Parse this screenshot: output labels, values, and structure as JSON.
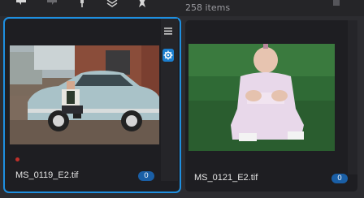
{
  "toolbar": {
    "icons": [
      "back-arrow-icon",
      "forward-arrow-icon",
      "pin-icon",
      "layers-icon",
      "star-icon"
    ],
    "item_count": "258 items"
  },
  "grid": {
    "items": [
      {
        "filename": "MS_0119_E2.tif",
        "badge": "0",
        "selected": true,
        "color_label": "#c0302a",
        "thumbnail": "vintage-car-photo"
      },
      {
        "filename": "MS_0121_E2.tif",
        "badge": "0",
        "selected": false,
        "thumbnail": "toddler-on-grass-photo"
      }
    ]
  },
  "colors": {
    "selection": "#1e8fe0",
    "badge": "#1a5fa6",
    "background": "#2b2b2f"
  }
}
